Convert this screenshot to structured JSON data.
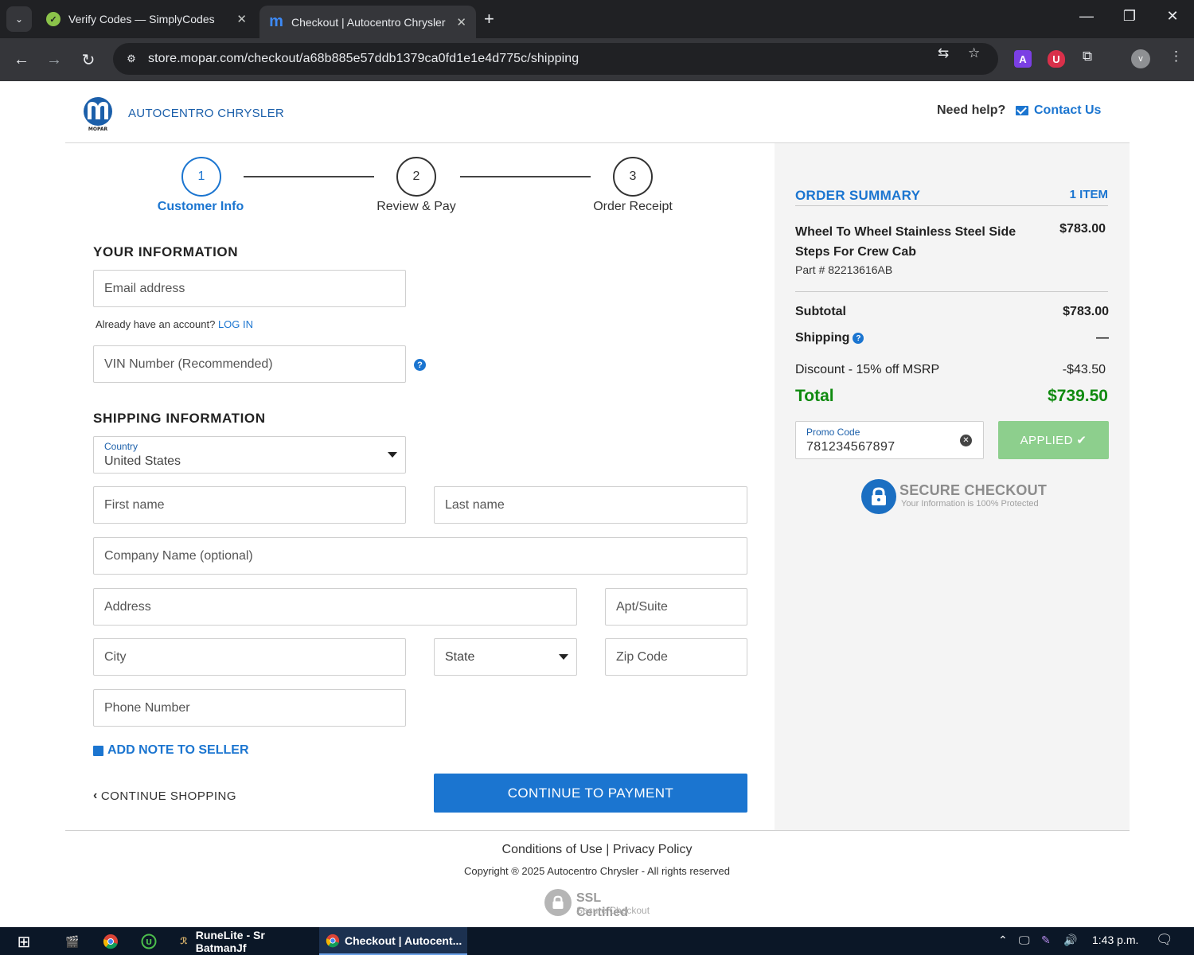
{
  "browser": {
    "tabs": [
      {
        "title": "Verify Codes — SimplyCodes",
        "active": false
      },
      {
        "title": "Checkout | Autocentro Chrysler",
        "active": true
      }
    ],
    "url": "store.mopar.com/checkout/a68b885e57ddb1379ca0fd1e1e4d775c/shipping"
  },
  "header": {
    "brand": "AUTOCENTRO CHRYSLER",
    "logo_text": "MOPAR",
    "help_text": "Need help?",
    "contact_label": "Contact Us"
  },
  "steps": [
    {
      "number": "1",
      "label": "Customer Info",
      "active": true
    },
    {
      "number": "2",
      "label": "Review & Pay",
      "active": false
    },
    {
      "number": "3",
      "label": "Order Receipt",
      "active": false
    }
  ],
  "your_info": {
    "title": "YOUR INFORMATION",
    "email_placeholder": "Email address",
    "account_prompt": "Already have an account?",
    "login_label": "LOG IN",
    "vin_placeholder": "VIN Number (Recommended)"
  },
  "shipping": {
    "title": "SHIPPING INFORMATION",
    "country_label": "Country",
    "country_value": "United States",
    "first_name_placeholder": "First name",
    "last_name_placeholder": "Last name",
    "company_placeholder": "Company Name (optional)",
    "address_placeholder": "Address",
    "apt_placeholder": "Apt/Suite",
    "city_placeholder": "City",
    "state_placeholder": "State",
    "zip_placeholder": "Zip Code",
    "phone_placeholder": "Phone Number",
    "note_label": "ADD NOTE TO SELLER",
    "continue_shopping": "CONTINUE SHOPPING",
    "continue_payment": "CONTINUE TO PAYMENT"
  },
  "summary": {
    "title": "ORDER SUMMARY",
    "item_count": "1 ITEM",
    "item": {
      "name": "Wheel To Wheel Stainless Steel Side Steps For Crew Cab",
      "price": "$783.00",
      "part": "Part # 82213616AB"
    },
    "subtotal_label": "Subtotal",
    "subtotal_value": "$783.00",
    "shipping_label": "Shipping",
    "shipping_value": "—",
    "discount_label": "Discount - 15% off MSRP",
    "discount_value": "-$43.50",
    "total_label": "Total",
    "total_value": "$739.50",
    "promo_label": "Promo Code",
    "promo_value": "781234567897",
    "applied_label": "APPLIED",
    "secure_title": "SECURE CHECKOUT",
    "secure_sub": "Your Information is 100% Protected"
  },
  "footer": {
    "conditions": "Conditions of Use",
    "separator": "|",
    "privacy": "Privacy Policy",
    "copyright": "Copyright ® 2025 Autocentro Chrysler - All rights reserved",
    "ssl_title": "SSL Certified",
    "ssl_sub": "Secure Checkout"
  },
  "taskbar": {
    "apps": [
      {
        "label": "RuneLite - Sr BatmanJf",
        "active": false
      },
      {
        "label": "Checkout | Autocent...",
        "active": true
      }
    ],
    "clock": "1:43 p.m."
  },
  "colors": {
    "brand_blue": "#1b75d0",
    "total_green": "#0f8a0f",
    "applied_green": "#8dcf8d"
  }
}
